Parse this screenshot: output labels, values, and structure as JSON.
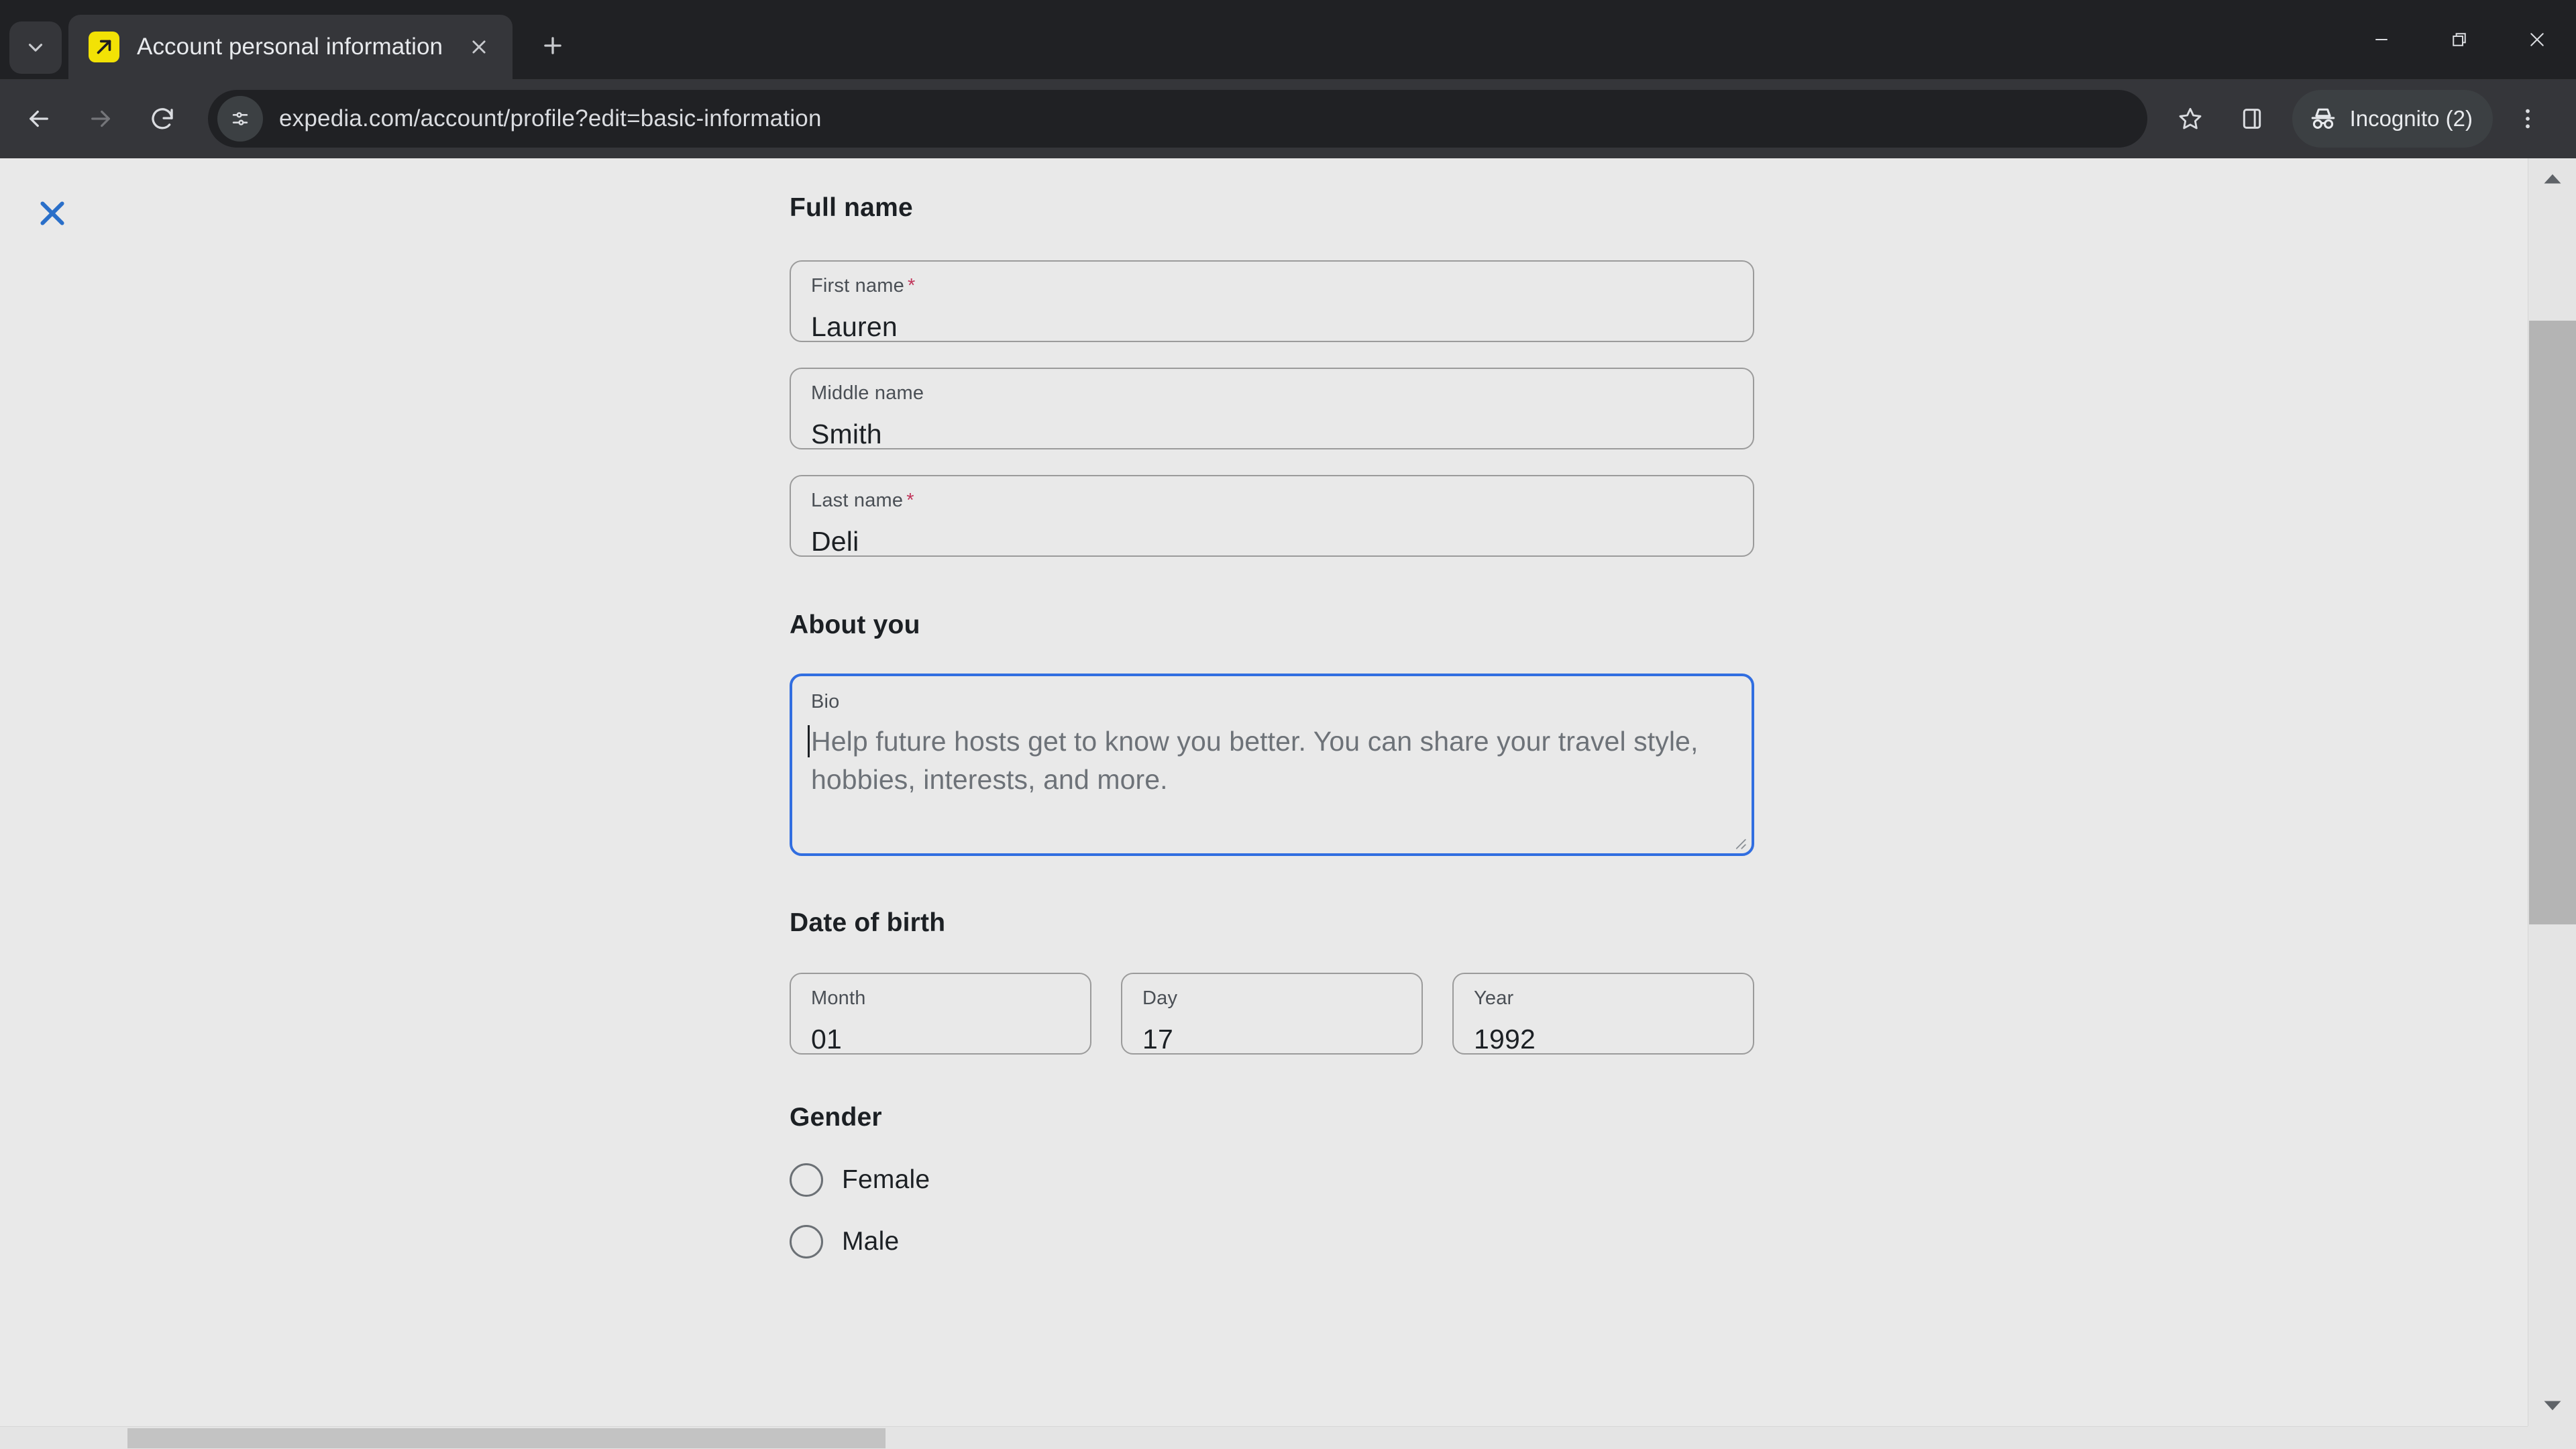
{
  "browser": {
    "tab": {
      "title": "Account personal information",
      "favicon_name": "expedia-favicon",
      "favicon_bg": "#f2e205"
    },
    "tab_search_tooltip": "Search tabs",
    "new_tab_tooltip": "New tab",
    "nav": {
      "back": "Back",
      "forward": "Forward",
      "reload": "Reload"
    },
    "omnibox": {
      "url": "expedia.com/account/profile?edit=basic-information",
      "site_info_icon": "tune-icon"
    },
    "actions": {
      "bookmark": "Bookmark this tab",
      "side_panel": "Show side panel",
      "menu": "Customize and control Google Chrome"
    },
    "profile": {
      "label": "Incognito (2)",
      "icon": "incognito-icon"
    },
    "window_controls": {
      "minimize": "Minimize",
      "restore": "Restore",
      "close": "Close"
    }
  },
  "page": {
    "close_button_label": "Close",
    "close_button_color": "#2a6fc9",
    "background": "#e9e9e9",
    "sections": {
      "full_name": {
        "heading": "Full name",
        "fields": [
          {
            "label": "First name",
            "required": true,
            "value": "Lauren"
          },
          {
            "label": "Middle name",
            "required": false,
            "value": "Smith"
          },
          {
            "label": "Last name",
            "required": true,
            "value": "Deli"
          }
        ]
      },
      "about_you": {
        "heading": "About you",
        "bio": {
          "label": "Bio",
          "value": "",
          "placeholder": "Help future hosts get to know you better. You can share your travel style, hobbies, interests, and more.",
          "focused": true,
          "focus_color": "#316ee0"
        }
      },
      "date_of_birth": {
        "heading": "Date of birth",
        "fields": [
          {
            "label": "Month",
            "value": "01"
          },
          {
            "label": "Day",
            "value": "17"
          },
          {
            "label": "Year",
            "value": "1992"
          }
        ]
      },
      "gender": {
        "heading": "Gender",
        "options": [
          {
            "label": "Female",
            "selected": false
          },
          {
            "label": "Male",
            "selected": false
          }
        ]
      }
    },
    "required_marker": "*",
    "required_marker_color": "#c1365b"
  }
}
